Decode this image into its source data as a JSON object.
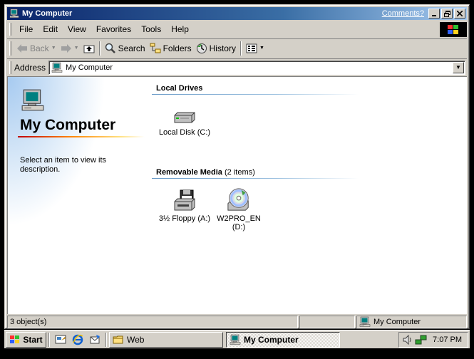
{
  "window": {
    "title": "My Computer",
    "comments_link": "Comments?",
    "buttons": {
      "minimize": "_",
      "maximize": "❐",
      "close": "✕"
    }
  },
  "menu": [
    "File",
    "Edit",
    "View",
    "Favorites",
    "Tools",
    "Help"
  ],
  "toolbar": {
    "back": "Back",
    "search": "Search",
    "folders": "Folders",
    "history": "History"
  },
  "address": {
    "label": "Address",
    "value": "My Computer"
  },
  "left_pane": {
    "title": "My Computer",
    "description": "Select an item to view its description."
  },
  "groups": [
    {
      "header": "Local Drives",
      "count": "",
      "items": [
        {
          "label": "Local Disk (C:)",
          "icon": "hard-disk-icon"
        }
      ]
    },
    {
      "header": "Removable Media",
      "count": "(2 items)",
      "items": [
        {
          "label": "3½ Floppy (A:)",
          "icon": "floppy-drive-icon"
        },
        {
          "label": "W2PRO_EN (D:)",
          "icon": "cd-drive-icon"
        }
      ]
    }
  ],
  "status": {
    "objects": "3 object(s)",
    "zone": "",
    "location": "My Computer"
  },
  "taskbar": {
    "start": "Start",
    "tasks": [
      {
        "label": "Web",
        "active": false,
        "icon": "folder-icon"
      },
      {
        "label": "My Computer",
        "active": true,
        "icon": "computer-icon"
      }
    ],
    "clock": "7:07 PM"
  },
  "colors": {
    "titlebar_start": "#0a246a",
    "titlebar_end": "#a6caf0",
    "face": "#d4d0c8"
  }
}
